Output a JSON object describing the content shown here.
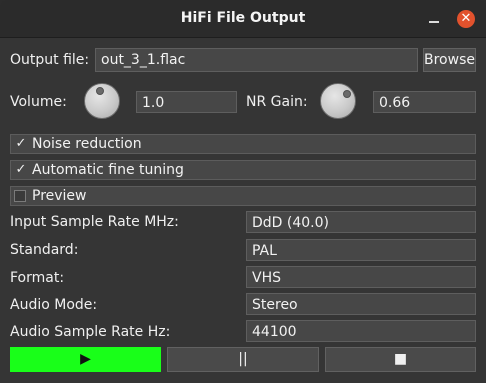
{
  "window": {
    "title": "HiFi File Output",
    "minimize_glyph": "",
    "close_glyph": "✕"
  },
  "output": {
    "label": "Output file:",
    "value": "out_3_1.flac",
    "browse_label": "Browse"
  },
  "volume": {
    "label": "Volume:",
    "value": "1.0"
  },
  "nr_gain": {
    "label": "NR Gain:",
    "value": "0.66"
  },
  "options": [
    {
      "label": "Noise reduction",
      "checked": true
    },
    {
      "label": "Automatic fine tuning",
      "checked": true
    },
    {
      "label": "Preview",
      "checked": false
    }
  ],
  "settings": [
    {
      "label": "Input Sample Rate MHz:",
      "value": "DdD (40.0)"
    },
    {
      "label": "Standard:",
      "value": "PAL"
    },
    {
      "label": "Format:",
      "value": "VHS"
    },
    {
      "label": "Audio Mode:",
      "value": "Stereo"
    },
    {
      "label": "Audio Sample Rate Hz:",
      "value": "44100"
    }
  ],
  "controls": {
    "play_glyph": "▶",
    "pause_glyph": "||",
    "stop_glyph": "■",
    "play_color": "#19ff19"
  },
  "check_glyph": "✓"
}
